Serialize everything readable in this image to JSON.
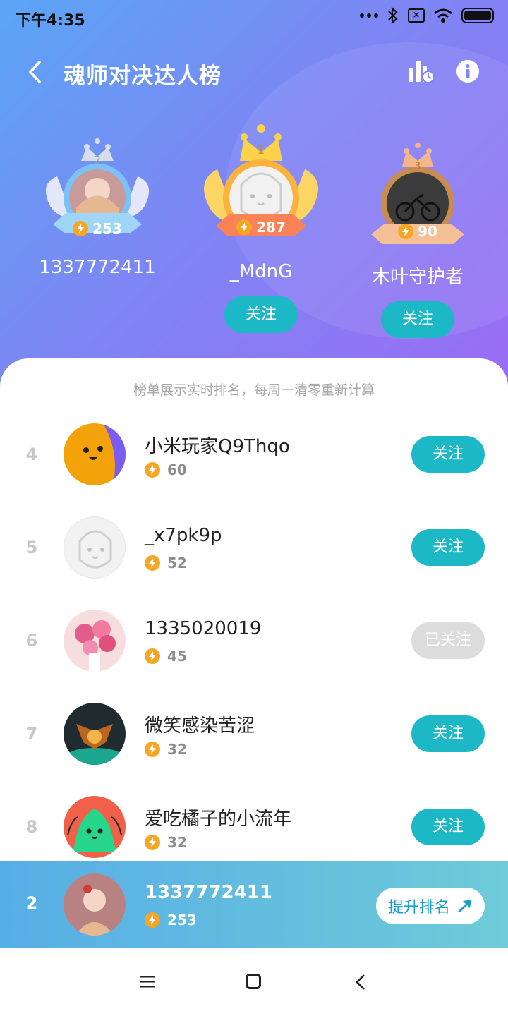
{
  "status_bar": {
    "time": "下午4:35"
  },
  "header": {
    "title": "魂师对决达人榜"
  },
  "podium": [
    {
      "rank": "2",
      "name": "1337772411",
      "score": "253",
      "follow": ""
    },
    {
      "rank": "1",
      "name": "_MdnG",
      "score": "287",
      "follow": "关注"
    },
    {
      "rank": "3",
      "name": "木叶守护者",
      "score": "90",
      "follow": "关注"
    }
  ],
  "notice": "榜单展示实时排名，每周一清零重新计算",
  "list": [
    {
      "rank": "4",
      "name": "小米玩家Q9Thqo",
      "score": "60",
      "button": "关注",
      "followed": false
    },
    {
      "rank": "5",
      "name": "_x7pk9p",
      "score": "52",
      "button": "关注",
      "followed": false
    },
    {
      "rank": "6",
      "name": "1335020019",
      "score": "45",
      "button": "已关注",
      "followed": true
    },
    {
      "rank": "7",
      "name": "微笑感染苦涩",
      "score": "32",
      "button": "关注",
      "followed": false
    },
    {
      "rank": "8",
      "name": "爱吃橘子的小流年",
      "score": "32",
      "button": "关注",
      "followed": false
    }
  ],
  "me": {
    "rank": "2",
    "name": "1337772411",
    "score": "253",
    "button": "提升排名"
  },
  "colors": {
    "accent": "#1cb8c6",
    "gold": "#f5a623"
  },
  "icons": [
    "back-icon",
    "leaderboard-history-icon",
    "info-icon",
    "lightning-icon",
    "arrow-up-icon",
    "menu-icon",
    "home-icon",
    "nav-back-icon"
  ]
}
